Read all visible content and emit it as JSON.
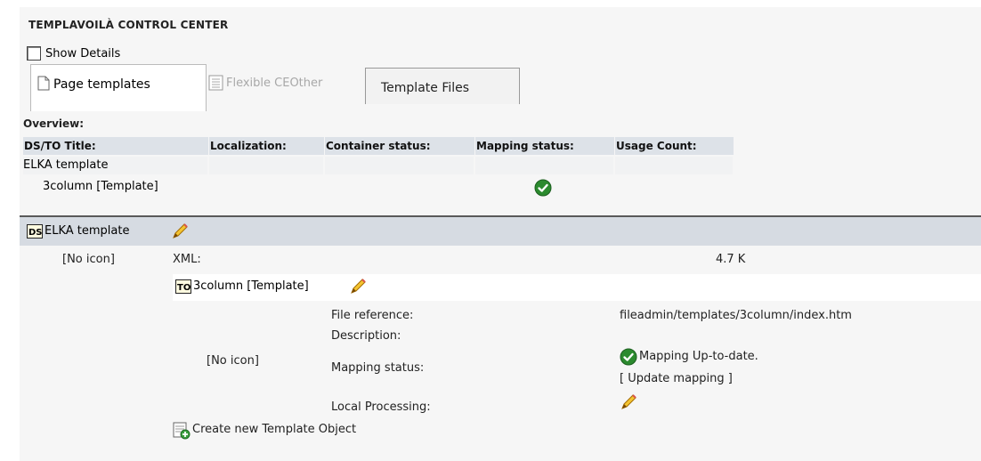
{
  "header": {
    "title": "TEMPLAVOILÀ CONTROL CENTER",
    "show_details_label": "Show Details"
  },
  "tabs": [
    {
      "label": "Page templates",
      "icon": "page-icon",
      "active": true
    },
    {
      "label": "Flexible CEOther",
      "icon": "document-icon",
      "disabled": true
    },
    {
      "label": "Template Files",
      "active": false
    }
  ],
  "overview": {
    "heading": "Overview:",
    "columns": [
      "DS/TO Title:",
      "Localization:",
      "Container status:",
      "Mapping status:",
      "Usage Count:"
    ],
    "rows": [
      {
        "title": "ELKA template",
        "mapping_ok": false
      },
      {
        "title": "3column [Template]",
        "mapping_ok": true
      }
    ]
  },
  "ds": {
    "badge": "DS",
    "title": "ELKA template",
    "no_icon": "[No icon]",
    "xml_label": "XML:",
    "xml_size": "4.7 K"
  },
  "to": {
    "badge": "TO",
    "title": "3column [Template]",
    "no_icon": "[No icon]",
    "file_ref_label": "File reference:",
    "file_ref_value": "fileadmin/templates/3column/index.htm",
    "description_label": "Description:",
    "mapping_label": "Mapping status:",
    "mapping_value": "Mapping Up-to-date.",
    "update_mapping": "[ Update mapping ]",
    "local_processing_label": "Local Processing:",
    "create_new": "Create new Template Object"
  },
  "colors": {
    "ok_green": "#2b8a2e",
    "header_bg": "#dde2e8",
    "ds_bar_bg": "#d6dbe2"
  }
}
